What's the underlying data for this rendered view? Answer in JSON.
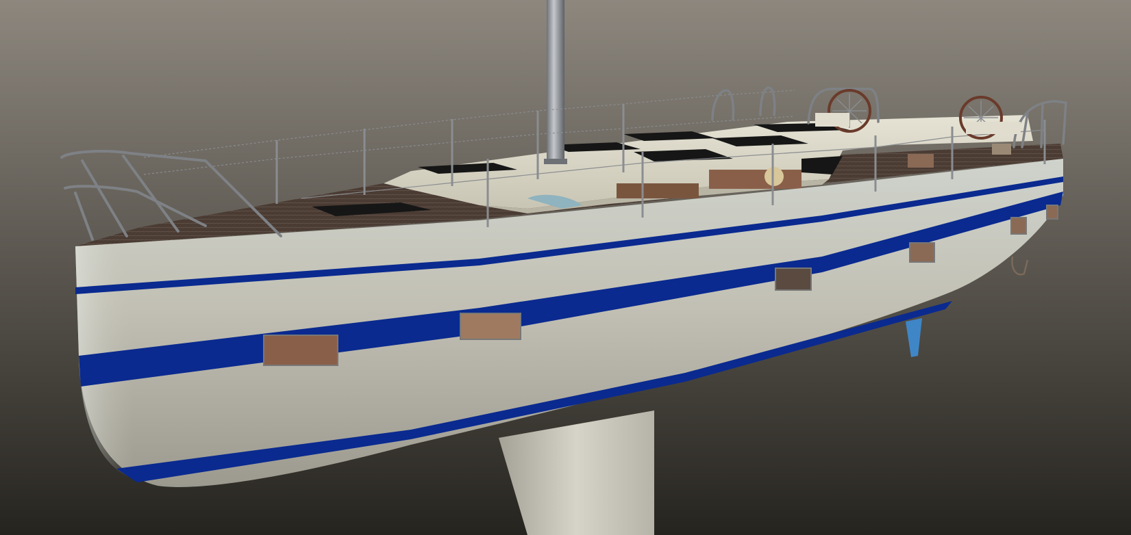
{
  "viewport": {
    "background_top": "#8d877e",
    "background_bottom": "#26241f"
  },
  "model": {
    "hull_color": "#c4c2b6",
    "stripe_color": "#0a2a8f",
    "deck_color": "#4a3b33",
    "cabin_color": "#dcd8c8",
    "hatch_color": "#161616",
    "rail_color": "#8a8d90",
    "mast_color": "#8f9398",
    "keel_color": "#d2d0c4",
    "rudder_color": "#3f86c7",
    "window_interior_color": "#8a5f49",
    "stanchion_count": 11,
    "hull_window_count": 6,
    "deck_hatch_count": 8
  }
}
